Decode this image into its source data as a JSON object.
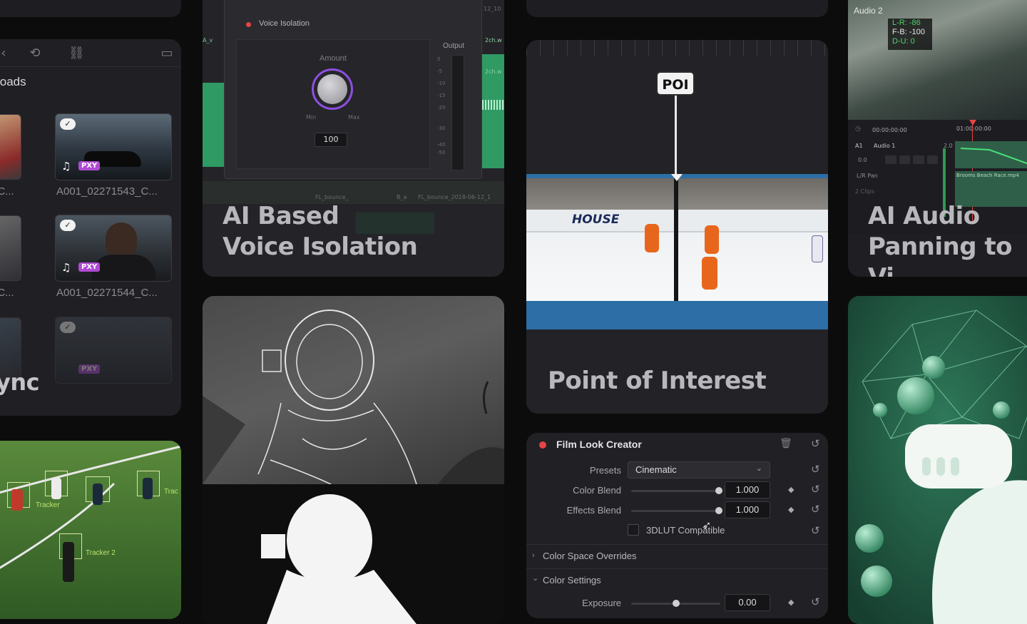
{
  "proxy_card": {
    "title": "loads",
    "sync_text": "ync",
    "clips": [
      {
        "name": "A001_02271543_C...",
        "badge": "PXY"
      },
      {
        "name": "A001_02271544_C...",
        "badge": "PXY"
      },
      {
        "name": "",
        "badge": "PXY"
      }
    ],
    "left_clips": [
      "_C...",
      "_C..."
    ]
  },
  "voice_card": {
    "panel_title": "Voice Isolation",
    "amount_label": "Amount",
    "min_label": "Min",
    "max_label": "Max",
    "amount_value": "100",
    "output_label": "Output",
    "meter_ticks": [
      "0",
      "-5",
      "-10",
      "-15",
      "-20",
      "-30",
      "-40",
      "-50"
    ],
    "track_labels": [
      "12_10",
      "2ch.w",
      "2ch.w",
      "A_v"
    ],
    "bottom_labels": [
      "FL_bounce_",
      "B_a",
      "FL_bounce_2018-06-12_1"
    ],
    "headline_line1": "AI Based",
    "headline_line2": "Voice Isolation"
  },
  "poi_card": {
    "marker_label": "POI",
    "banner_text": "HOUSE",
    "headline": "Point of Interest"
  },
  "film_card": {
    "title": "Film Look Creator",
    "presets_label": "Presets",
    "presets_value": "Cinematic",
    "color_blend_label": "Color Blend",
    "color_blend_value": "1.000",
    "effects_blend_label": "Effects Blend",
    "effects_blend_value": "1.000",
    "lut_label": "3DLUT Compatible",
    "section_overrides": "Color Space Overrides",
    "section_settings": "Color Settings",
    "exposure_label": "Exposure",
    "exposure_value": "0.00"
  },
  "audio_card": {
    "track_name": "Audio 2",
    "readout_lr": "L-R: -86",
    "readout_fb": "F-B: -100",
    "readout_du": "D-U: 0",
    "timecode": "00:00:00:00",
    "ruler_tc": "01:00:00:00",
    "track_id": "A1",
    "track_title": "Audio 1",
    "track_ch": "2.0",
    "gain": "0.0",
    "pan_label": "L/R Pan",
    "clips": "2 Clips",
    "clip_name": "Brooms Beach Race.mp4",
    "headline_line1": "AI Audio",
    "headline_line2": "Panning to Vi"
  },
  "soccer_card": {
    "tracker_labels": [
      "Tracker",
      "Tracker 2",
      "Trac"
    ]
  },
  "colors": {
    "accent_purple": "#9b5de5",
    "record_red": "#e64545",
    "track_green": "#2f9a63",
    "vr_green": "#1f5b44"
  }
}
